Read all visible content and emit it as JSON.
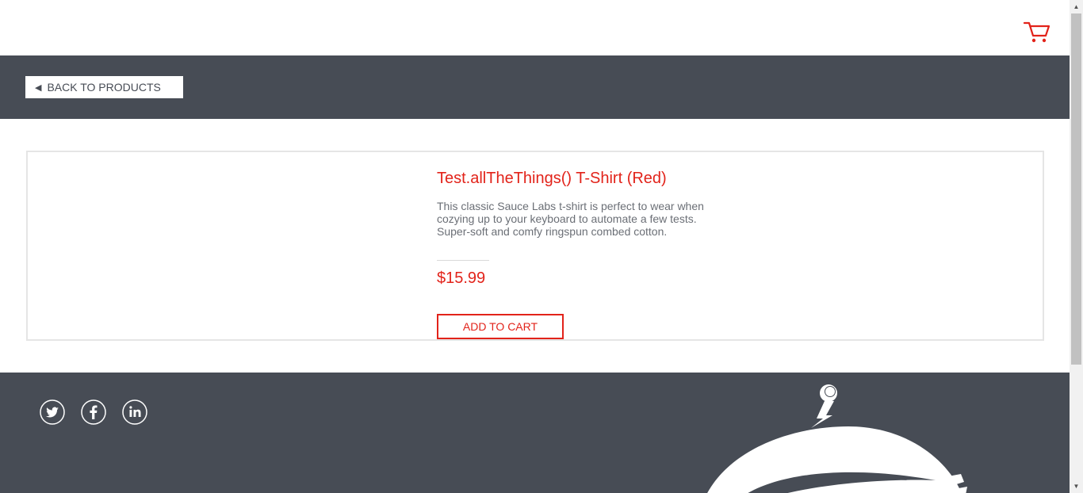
{
  "header": {
    "cart_icon": "shopping-cart-icon"
  },
  "subheader": {
    "back_arrow": "◀",
    "back_label": "BACK TO PRODUCTS"
  },
  "product": {
    "name": "Test.allTheThings() T-Shirt (Red)",
    "description": "This classic Sauce Labs t-shirt is perfect to wear when cozying up to your keyboard to automate a few tests. Super-soft and comfy ringspun combed cotton.",
    "price": "$15.99",
    "add_to_cart_label": "ADD TO CART"
  },
  "footer": {
    "social_icons": [
      "twitter-icon",
      "facebook-icon",
      "linkedin-icon"
    ],
    "mascot_icon": "swag-bot-logo"
  },
  "colors": {
    "accent": "#e2231a",
    "dark": "#474c55",
    "text_muted": "#6b6f76"
  }
}
